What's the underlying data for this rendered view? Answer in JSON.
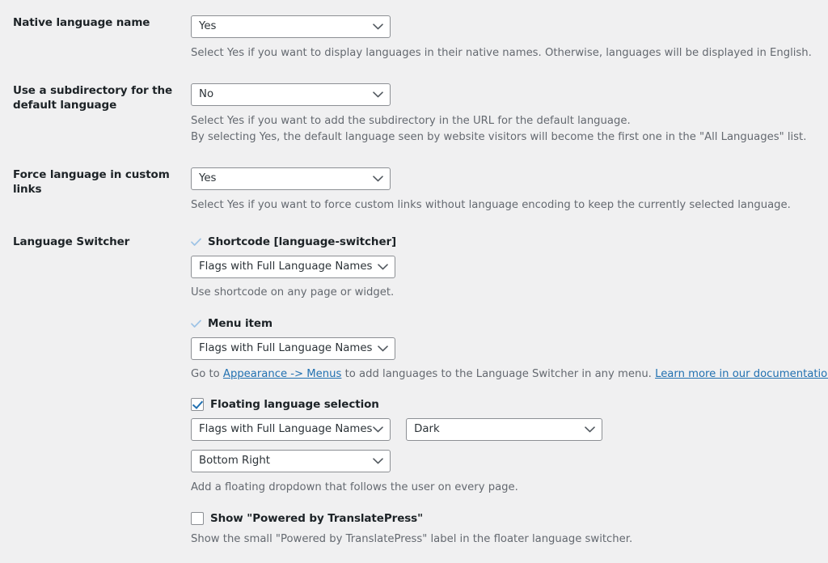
{
  "settings": {
    "rows": [
      {
        "label": "Native language name",
        "select": {
          "value": "Yes",
          "icon": "chevron-down-icon",
          "name": "native-language-name-select"
        },
        "descriptions": [
          "Select Yes if you want to display languages in their native names. Otherwise, languages will be displayed in English."
        ]
      },
      {
        "label": "Use a subdirectory for the default language",
        "select": {
          "value": "No",
          "icon": "chevron-down-icon",
          "name": "subdirectory-default-language-select"
        },
        "descriptions": [
          "Select Yes if you want to add the subdirectory in the URL for the default language.",
          "By selecting Yes, the default language seen by website visitors will become the first one in the \"All Languages\" list."
        ]
      },
      {
        "label": "Force language in custom links",
        "select": {
          "value": "Yes",
          "icon": "chevron-down-icon",
          "name": "force-language-custom-links-select"
        },
        "descriptions": [
          "Select Yes if you want to force custom links without language encoding to keep the currently selected language."
        ]
      }
    ]
  },
  "language_switcher": {
    "label": "Language Switcher",
    "shortcode": {
      "title": "Shortcode [language-switcher]",
      "check_state": "tick",
      "select": {
        "value": "Flags with Full Language Names",
        "icon": "chevron-down-icon"
      },
      "description": "Use shortcode on any page or widget."
    },
    "menu_item": {
      "title": "Menu item",
      "check_state": "tick",
      "select": {
        "value": "Flags with Full Language Names",
        "icon": "chevron-down-icon"
      },
      "description_pre": "Go to ",
      "link1": "Appearance -> Menus",
      "description_mid": " to add languages to the Language Switcher in any menu. ",
      "link2": "Learn more in our documentation."
    },
    "floating": {
      "title": "Floating language selection",
      "check_state": "checked",
      "select_style": {
        "value": "Flags with Full Language Names",
        "icon": "chevron-down-icon"
      },
      "select_theme": {
        "value": "Dark",
        "icon": "chevron-down-icon"
      },
      "select_position": {
        "value": "Bottom Right",
        "icon": "chevron-down-icon"
      },
      "description": "Add a floating dropdown that follows the user on every page."
    },
    "powered_by": {
      "title": "Show \"Powered by TranslatePress\"",
      "check_state": "unchecked",
      "description": "Show the small \"Powered by TranslatePress\" label in the floater language switcher."
    }
  },
  "colors": {
    "background": "#f0f0f1",
    "label_text": "#1d2327",
    "description_text": "#646970",
    "link": "#2271b1",
    "border": "#8c8f94",
    "accent_check": "#2271b1",
    "tick_light": "#a7c6e5"
  }
}
